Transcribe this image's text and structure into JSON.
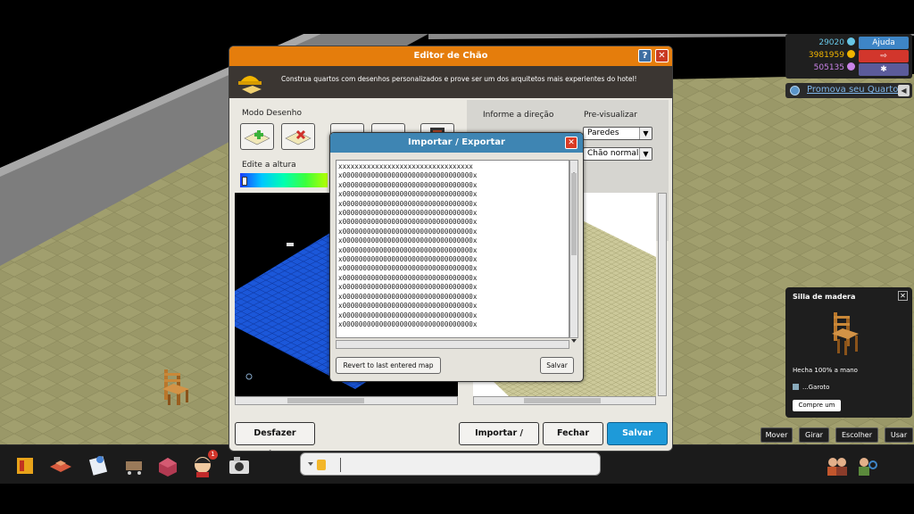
{
  "hud": {
    "diamonds": "29020",
    "credits": "3981959",
    "duckets": "505135",
    "help_label": "Ajuda",
    "colors": {
      "diamonds": "#67c6e6",
      "credits": "#f0b400",
      "duckets": "#c983e8"
    }
  },
  "promote": {
    "label": "Promova seu Quarto"
  },
  "editor": {
    "title": "Editor de Chão",
    "banner_text": "Construa quartos com desenhos personalizados e prove ser um dos arquitetos mais experientes do hotel!",
    "draw_mode_label": "Modo Desenho",
    "edit_height_label": "Edite a altura",
    "direction_label": "Informe a direção",
    "preview_label": "Pre-visualizar",
    "walls_option": "Paredes normais",
    "floor_option": "Chão normal",
    "undo_label": "Desfazer mudanças",
    "import_export_label": "Importar / Exportar",
    "close_label": "Fechar",
    "save_label": "Salvar"
  },
  "dialog": {
    "title": "Importar / Exportar",
    "map_text": "xxxxxxxxxxxxxxxxxxxxxxxxxxxxxxxxx\nx00000000000000000000000000000000x\nx00000000000000000000000000000000x\nx00000000000000000000000000000000x\nx00000000000000000000000000000000x\nx00000000000000000000000000000000x\nx00000000000000000000000000000000x\nx00000000000000000000000000000000x\nx00000000000000000000000000000000x\nx00000000000000000000000000000000x\nx00000000000000000000000000000000x\nx00000000000000000000000000000000x\nx00000000000000000000000000000000x\nx00000000000000000000000000000000x\nx00000000000000000000000000000000x\nx00000000000000000000000000000000x\nx00000000000000000000000000000000x\nx00000000000000000000000000000000x",
    "revert_label": "Revert to last entered map",
    "save_label": "Salvar"
  },
  "furni": {
    "name": "Silla de madera",
    "description": "Hecha 100% a mano",
    "owner": "...Garoto",
    "buy_label": "Compre um"
  },
  "actions": {
    "move": "Mover",
    "rotate": "Girar",
    "pick": "Escolher",
    "use": "Usar"
  },
  "toolbar": {
    "notification_count": "1"
  },
  "colors": {
    "editor_title": "#e57d0c",
    "dialog_title": "#3e85b3",
    "save_button": "#1e9ad9",
    "floor_draw": "#1b57d9",
    "floor_preview": "#ccc99a"
  }
}
